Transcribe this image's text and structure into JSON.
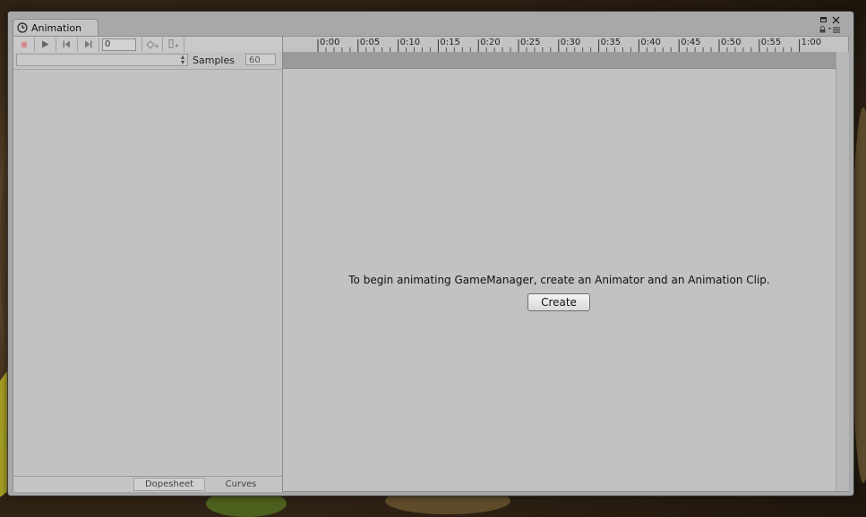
{
  "window": {
    "tab_title": "Animation"
  },
  "toolbar": {
    "frame_value": "0"
  },
  "clip": {
    "selected_clip": "",
    "samples_label": "Samples",
    "samples_value": "60"
  },
  "ruler": {
    "ticks": [
      "0:00",
      "0:05",
      "0:10",
      "0:15",
      "0:20",
      "0:25",
      "0:30",
      "0:35",
      "0:40",
      "0:45",
      "0:50",
      "0:55",
      "1:00"
    ]
  },
  "main": {
    "message": "To begin animating GameManager, create an Animator and an Animation Clip.",
    "create_label": "Create"
  },
  "bottom_tabs": {
    "dopesheet": "Dopesheet",
    "curves": "Curves"
  },
  "colors": {
    "record": "#d88a8a",
    "panel": "#c2c2c2",
    "event_bar": "#9a9a9a"
  }
}
